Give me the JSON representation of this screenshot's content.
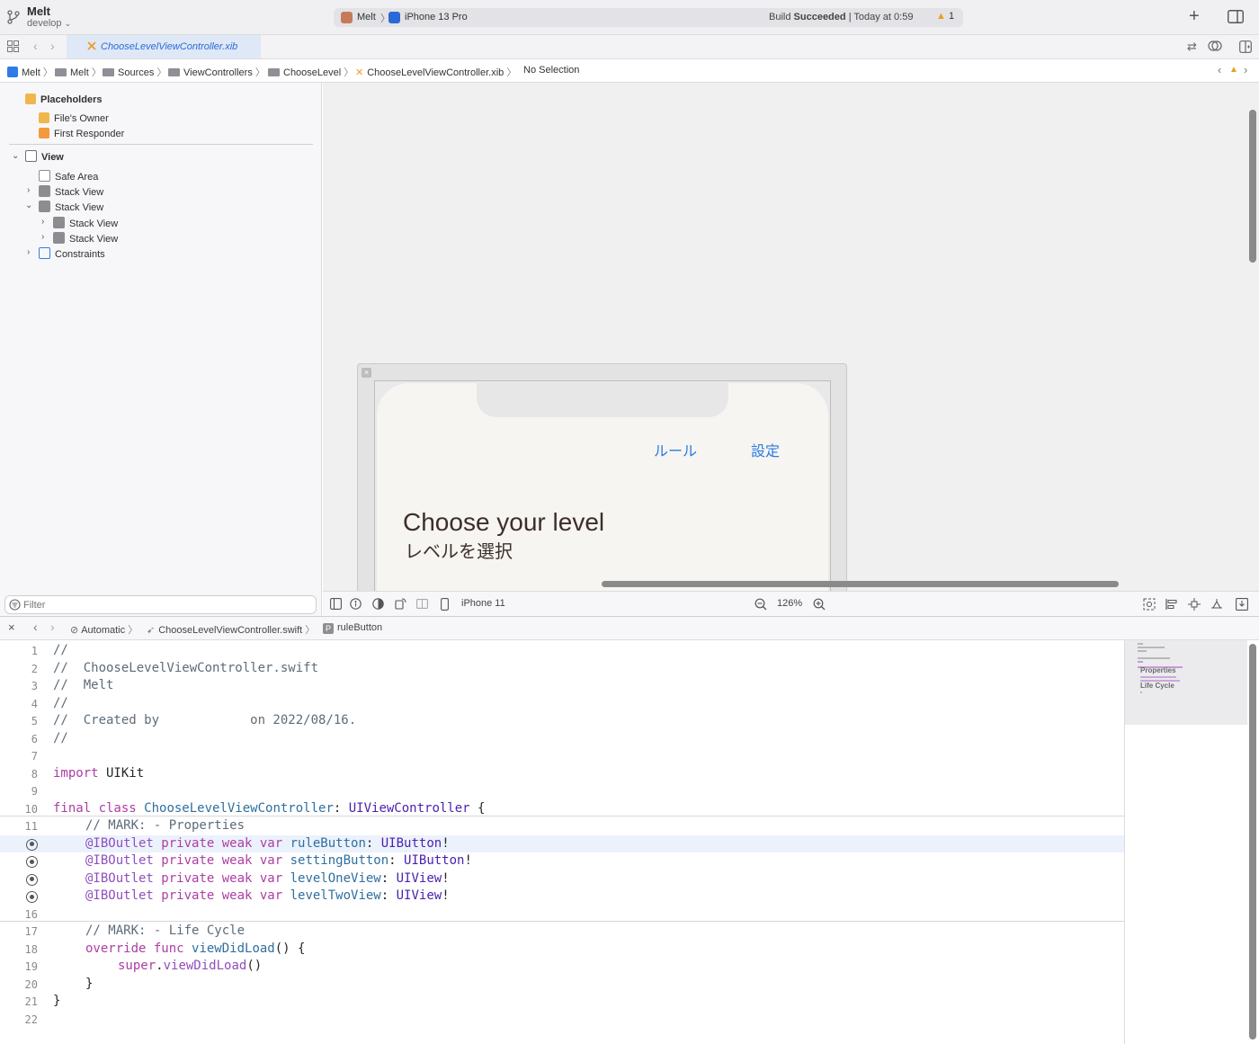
{
  "titlebar": {
    "project": "Melt",
    "branch": "develop",
    "scheme": "Melt",
    "device": "iPhone 13 Pro",
    "build_word": "Build",
    "build_result": "Succeeded",
    "build_time": "| Today at 0:59",
    "warning_count": "1"
  },
  "tab": {
    "label": "ChooseLevelViewController.xib"
  },
  "jumpbar": {
    "crumbs": [
      "Melt",
      "Melt",
      "Sources",
      "ViewControllers",
      "ChooseLevel",
      "ChooseLevelViewController.xib",
      "No Selection"
    ]
  },
  "navigator": {
    "placeholders": "Placeholders",
    "files_owner": "File's Owner",
    "first_responder": "First Responder",
    "view": "View",
    "safe_area": "Safe Area",
    "stack_view_1": "Stack View",
    "stack_view_2": "Stack View",
    "stack_view_2a": "Stack View",
    "stack_view_2b": "Stack View",
    "constraints": "Constraints",
    "filter_placeholder": "Filter"
  },
  "scene": {
    "rule_button": "ルール",
    "setting_button": "設定",
    "title": "Choose your level",
    "subtitle": "レベルを選択"
  },
  "canvasbar": {
    "device_config": "iPhone 11",
    "zoom": "126%"
  },
  "editorbar": {
    "crumbs": [
      "Automatic",
      "ChooseLevelViewController.swift",
      "ruleButton"
    ]
  },
  "code": {
    "l1": "//",
    "l2": "//  ChooseLevelViewController.swift",
    "l3": "//  Melt",
    "l4": "//",
    "l5": "//  Created by            on 2022/08/16.",
    "l6": "//",
    "l8_kw": "import",
    "l8_mod": " UIKit",
    "l10_kw": "final class",
    "l10_name": "ChooseLevelViewController",
    "l10_super": "UIViewController",
    "l11": "// MARK: - Properties",
    "outlets": [
      {
        "name": "ruleButton",
        "type": "UIButton"
      },
      {
        "name": "settingButton",
        "type": "UIButton"
      },
      {
        "name": "levelOneView",
        "type": "UIView"
      },
      {
        "name": "levelTwoView",
        "type": "UIView"
      }
    ],
    "outlet_attr": "@IBOutlet",
    "outlet_kw": "private weak var",
    "l17": "// MARK: - Life Cycle",
    "l18_kw": "override func",
    "l18_name": "viewDidLoad",
    "l19_kw": "super",
    "l19_call": "viewDidLoad"
  },
  "minimap": {
    "properties": "Properties",
    "life_cycle": "Life Cycle"
  }
}
